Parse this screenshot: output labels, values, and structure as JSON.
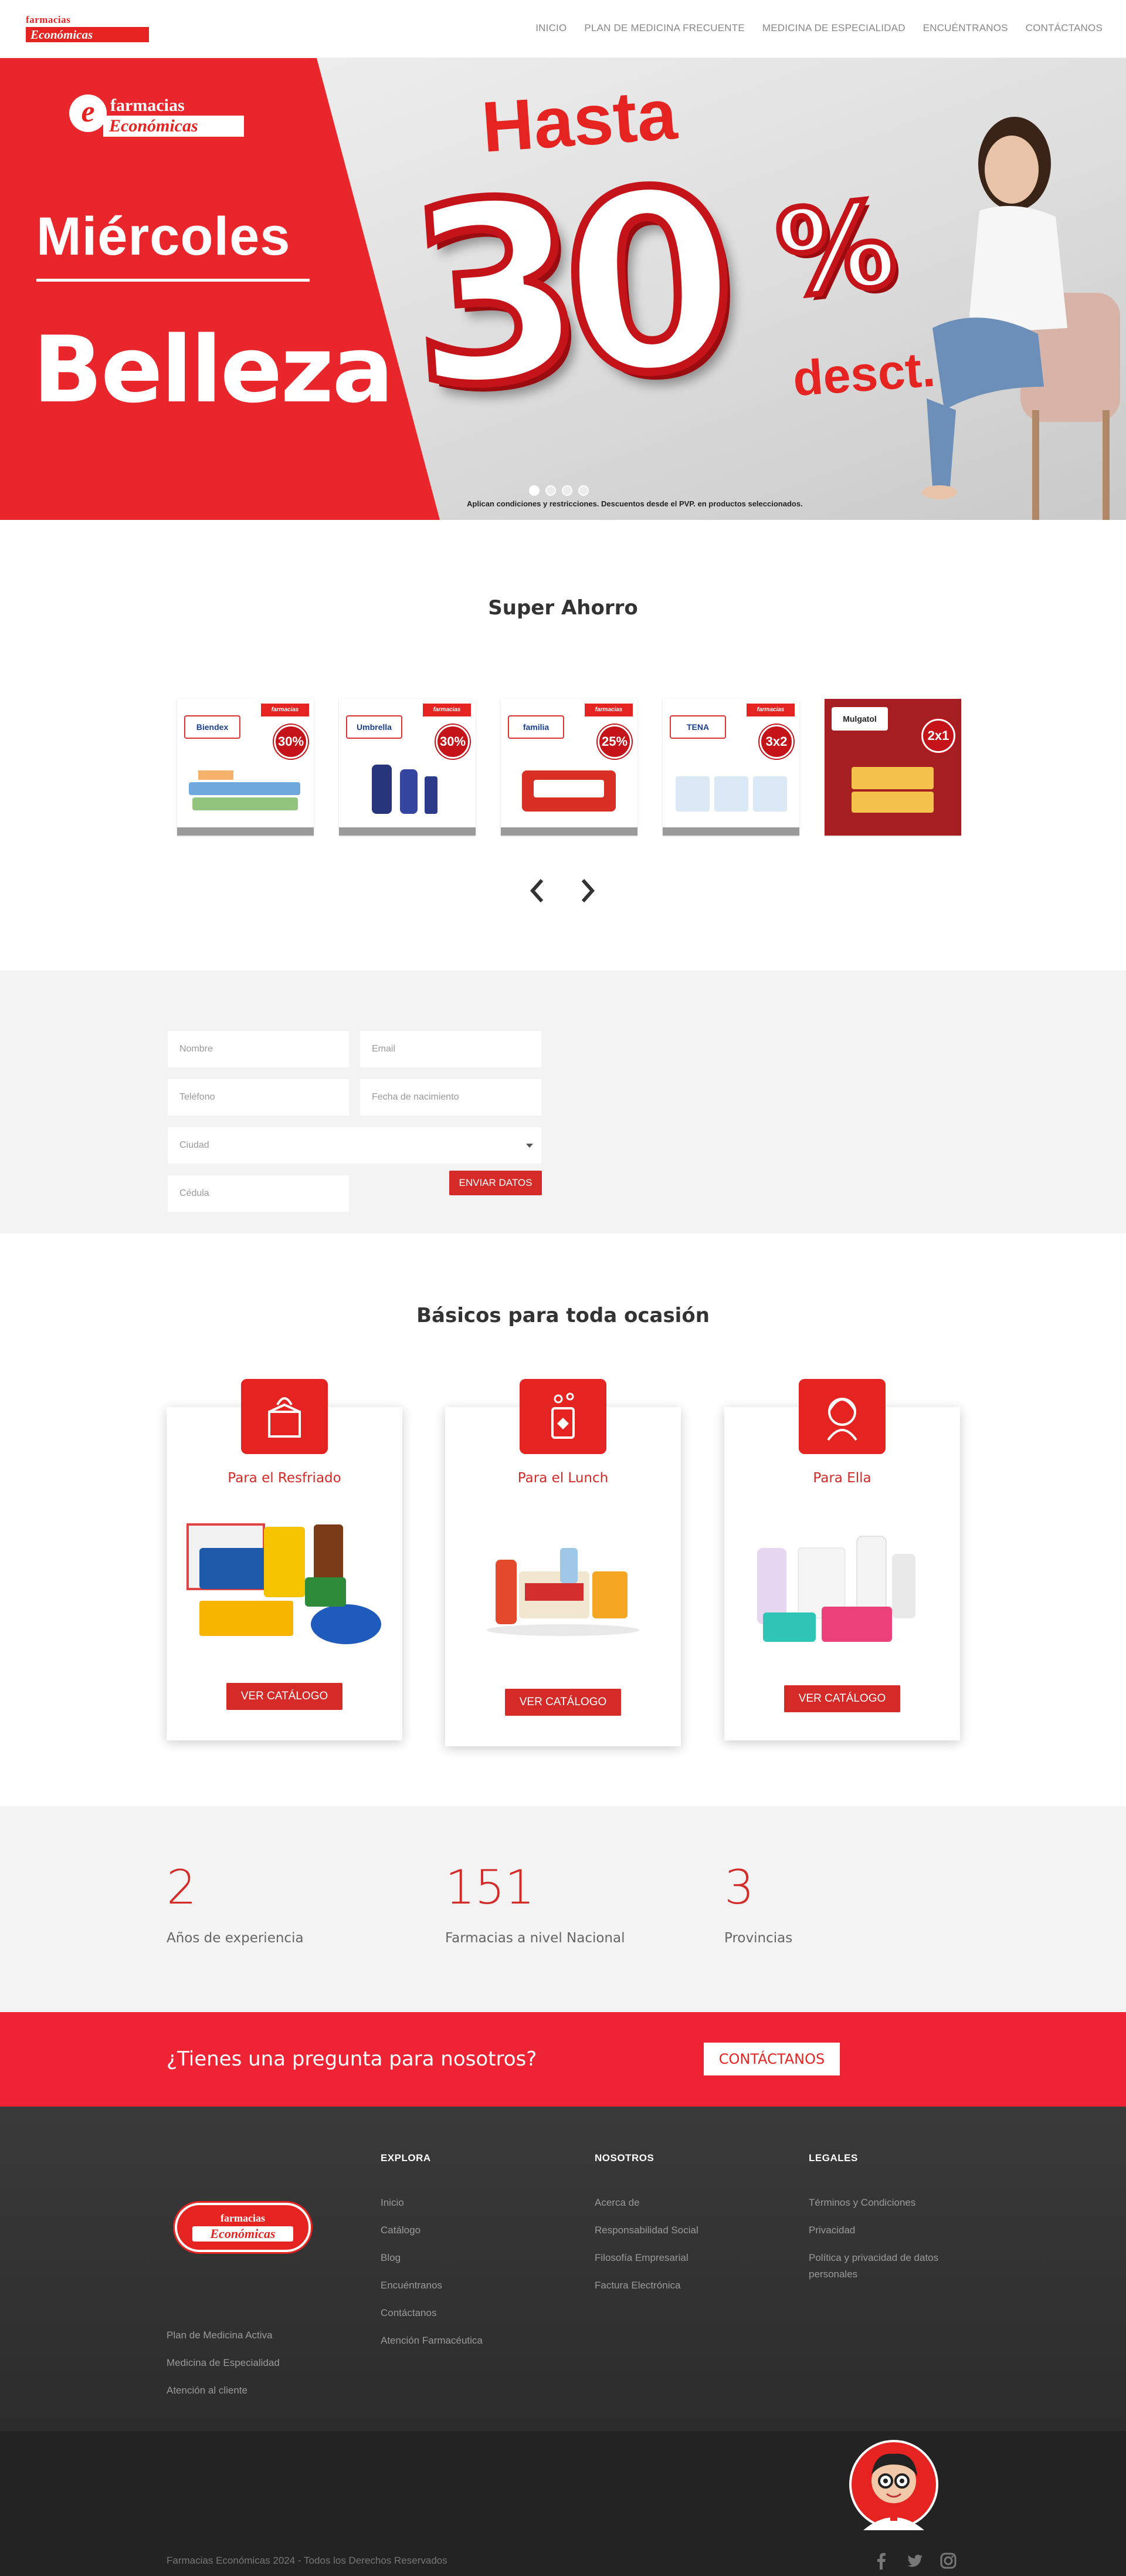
{
  "header": {
    "logo_top": "farmacias",
    "logo_bottom": "Económicas",
    "nav": [
      "INICIO",
      "PLAN DE MEDICINA FRECUENTE",
      "MEDICINA DE ESPECIALIDAD",
      "ENCUÉNTRANOS",
      "CONTÁCTANOS"
    ]
  },
  "hero": {
    "logo_top": "farmacias",
    "logo_bottom": "Económicas",
    "day": "Miércoles",
    "category": "Belleza",
    "hasta": "Hasta",
    "discount": "30",
    "percent": "%",
    "desct": "desct.",
    "note": "Aplican condiciones y restricciones. Descuentos desde el PVP. en productos seleccionados.",
    "slides": 4,
    "active_slide": 1
  },
  "super_ahorro": {
    "title": "Super Ahorro",
    "products": [
      {
        "brand": "Biendex",
        "badge": "30%",
        "logo": "farmacias Económicas"
      },
      {
        "brand": "Umbrella",
        "badge": "30%",
        "logo": "farmacias Económicas"
      },
      {
        "brand": "familia",
        "badge": "25%",
        "logo": "farmacias Económicas"
      },
      {
        "brand": "TENA",
        "badge": "3x2",
        "logo": "farmacias Económicas"
      },
      {
        "brand": "Mulgatol",
        "badge": "2x1",
        "logo": "Mulgatol"
      }
    ]
  },
  "form": {
    "name_placeholder": "Nombre",
    "email_placeholder": "Email",
    "phone_placeholder": "Teléfono",
    "birth_placeholder": "Fecha de nacimiento",
    "city_placeholder": "Ciudad",
    "id_placeholder": "Cédula",
    "submit_label": "ENVIAR DATOS"
  },
  "basicos": {
    "title": "Básicos para toda ocasión",
    "cards": [
      {
        "title": "Para el Resfriado",
        "button": "VER CATÁLOGO",
        "icon": "tissue-box-icon"
      },
      {
        "title": "Para el Lunch",
        "button": "VER CATÁLOGO",
        "icon": "lunch-drink-icon"
      },
      {
        "title": "Para Ella",
        "button": "VER CATÁLOGO",
        "icon": "woman-icon"
      }
    ]
  },
  "stats": [
    {
      "value": "2",
      "label": "Años de experiencia"
    },
    {
      "value": "151",
      "label": "Farmacias a nivel Nacional"
    },
    {
      "value": "3",
      "label": "Provincias"
    }
  ],
  "cta": {
    "question": "¿Tienes una pregunta para nosotros?",
    "button": "CONTÁCTANOS"
  },
  "footer": {
    "logo_top": "farmacias",
    "logo_bottom": "Económicas",
    "left_links": [
      "Plan de Medicina Activa",
      "Medicina de Especialidad",
      "Atención al cliente"
    ],
    "explora": {
      "heading": "EXPLORA",
      "links": [
        "Inicio",
        "Catálogo",
        "Blog",
        "Encuéntranos",
        "Contáctanos",
        "Atención Farmacéutica"
      ]
    },
    "nosotros": {
      "heading": "NOSOTROS",
      "links": [
        "Acerca de",
        "Responsabilidad Social",
        "Filosofía Empresarial",
        "Factura Electrónica"
      ]
    },
    "legales": {
      "heading": "LEGALES",
      "links": [
        "Términos y Condiciones",
        "Privacidad",
        "Política y privacidad de datos personales"
      ]
    },
    "copyright": "Farmacias Económicas 2024 - Todos los Derechos Reservados",
    "social": [
      "facebook-icon",
      "twitter-icon",
      "instagram-icon"
    ]
  },
  "colors": {
    "brand_red": "#e52421",
    "button_red": "#d42a28",
    "cta_red": "#ee2434",
    "footer_dark": "#2c2c2c"
  }
}
